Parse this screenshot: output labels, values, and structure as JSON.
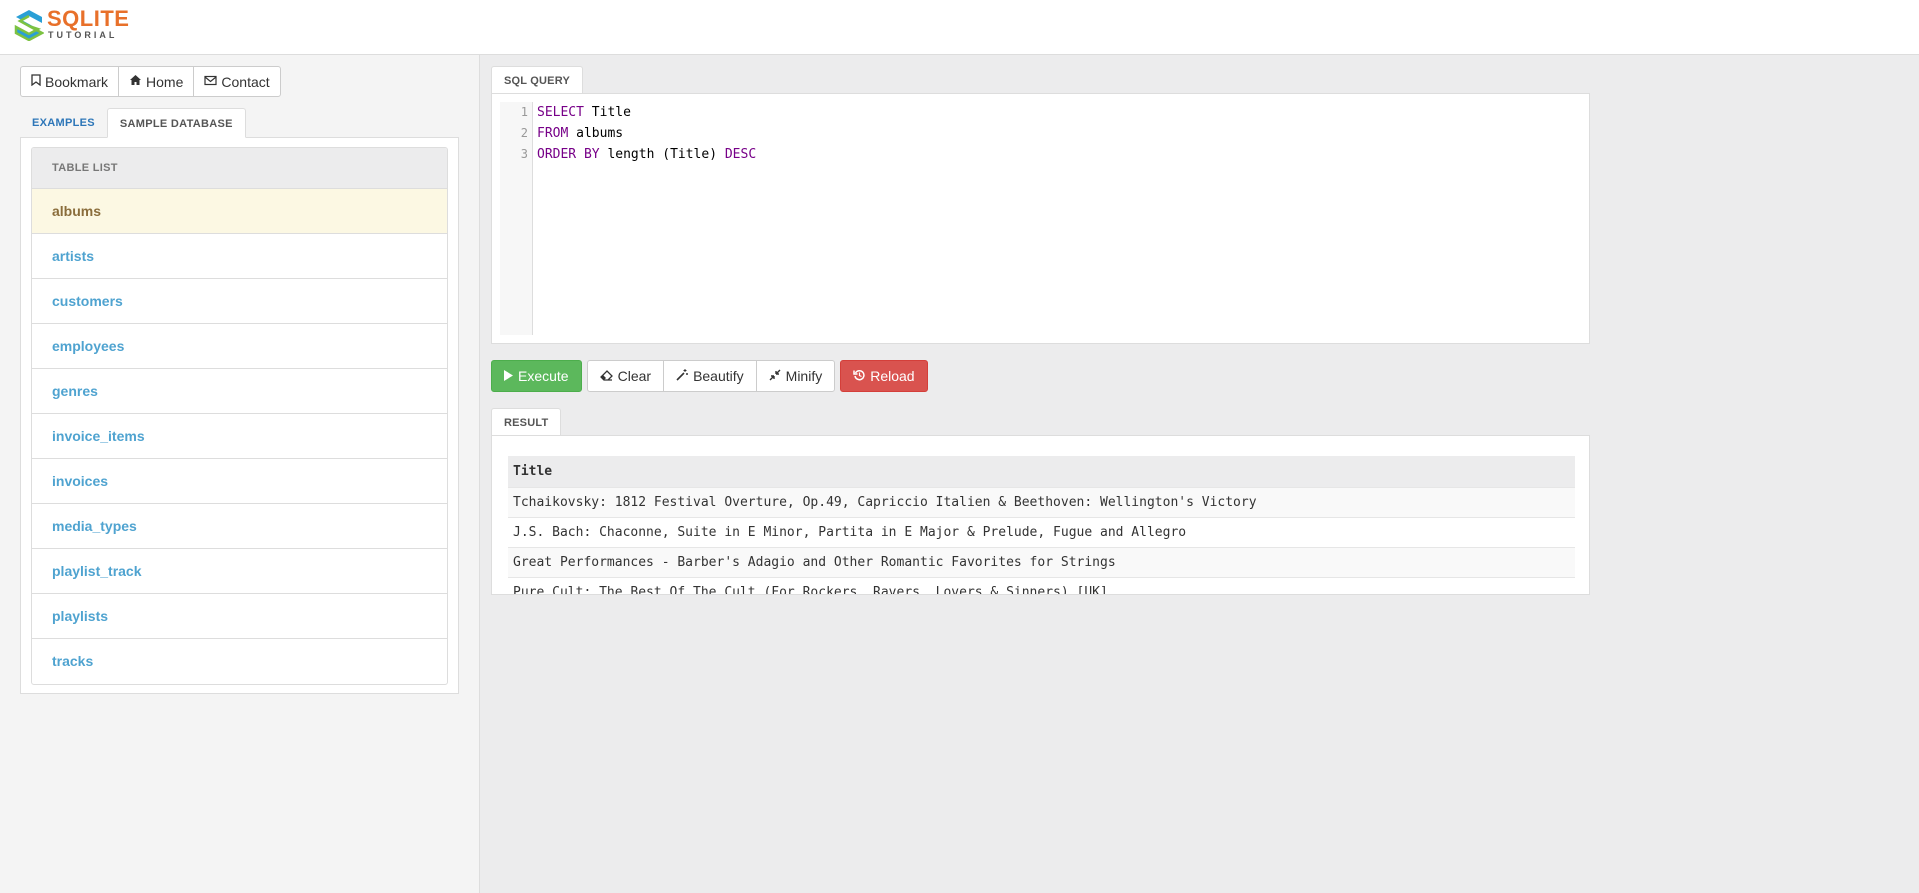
{
  "logo": {
    "main": "SQLITE",
    "sub": "TUTORIAL"
  },
  "left": {
    "buttons": [
      {
        "label": "Bookmark",
        "icon": "bookmark-icon"
      },
      {
        "label": "Home",
        "icon": "home-icon"
      },
      {
        "label": "Contact",
        "icon": "envelope-icon"
      }
    ],
    "tabs": [
      {
        "label": "EXAMPLES",
        "active": false
      },
      {
        "label": "SAMPLE DATABASE",
        "active": true
      }
    ],
    "table_list": {
      "header": "TABLE LIST",
      "items": [
        "albums",
        "artists",
        "customers",
        "employees",
        "genres",
        "invoice_items",
        "invoices",
        "media_types",
        "playlist_track",
        "playlists",
        "tracks"
      ],
      "active_item": "albums"
    }
  },
  "sql": {
    "tab_label": "SQL QUERY",
    "line_numbers": [
      "1",
      "2",
      "3"
    ],
    "lines": [
      {
        "kw": "SELECT",
        "rest": " Title"
      },
      {
        "kw": "FROM",
        "rest": " albums"
      },
      {
        "kw": "ORDER BY",
        "rest": " length (Title) ",
        "kw2": "DESC"
      }
    ]
  },
  "actions": {
    "execute": "Execute",
    "clear": "Clear",
    "beautify": "Beautify",
    "minify": "Minify",
    "reload": "Reload"
  },
  "result": {
    "tab_label": "RESULT",
    "columns": [
      "Title"
    ],
    "rows": [
      "Tchaikovsky: 1812 Festival Overture, Op.49, Capriccio Italien & Beethoven: Wellington's Victory",
      "J.S. Bach: Chaconne, Suite in E Minor, Partita in E Major & Prelude, Fugue and Allegro",
      "Great Performances - Barber's Adagio and Other Romantic Favorites for Strings",
      "Pure Cult: The Best Of The Cult (For Rockers, Ravers, Lovers & Sinners) [UK]"
    ]
  },
  "colors": {
    "accent_orange": "#e8702a",
    "link_blue": "#4fa3d0",
    "execute_green": "#5cb85c",
    "reload_red": "#d9534f",
    "active_row": "#fcf8e3"
  }
}
